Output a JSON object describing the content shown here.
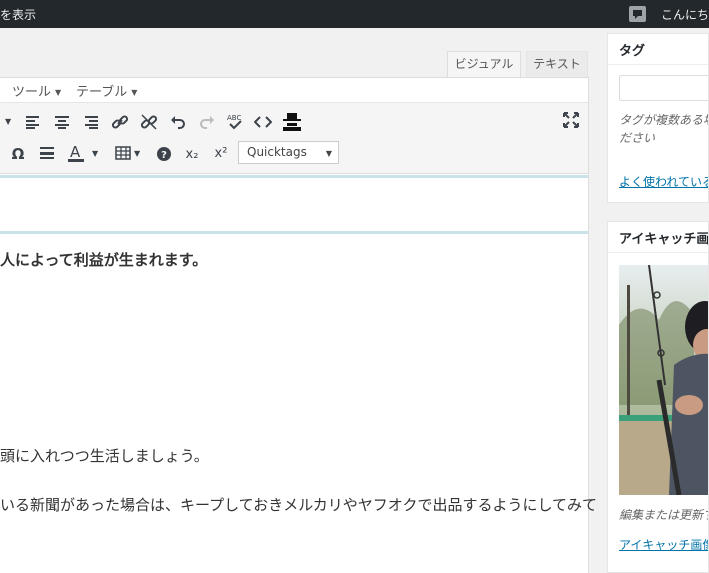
{
  "admin_bar": {
    "view_label": "を表示",
    "greeting": "こんにち"
  },
  "editor": {
    "tabs": {
      "visual": "ビジュアル",
      "text": "テキスト"
    },
    "menus": {
      "tools": "ツール",
      "table": "テーブル"
    },
    "toolbar": {
      "quicktags_select": "Quicktags",
      "text_color_glyph": "A",
      "special_char_glyph": "Ω",
      "help_glyph": "?",
      "subscript_glyph": "x₂",
      "superscript_glyph": "x²"
    },
    "content": {
      "line1": "人によって利益が生まれます。",
      "line2": "頭に入れつつ生活しましょう。",
      "line3": "いる新聞があった場合は、キープしておきメルカリやヤフオクで出品するようにしてみて"
    }
  },
  "sidebar": {
    "tags": {
      "title": "タグ",
      "hint_line1": "タグが複数ある場",
      "hint_line2": "ださい",
      "popular_link": "よく使われている"
    },
    "featured_image": {
      "title": "アイキャッチ画像",
      "hint": "編集または更新す",
      "link": "アイキャッチ画像"
    }
  },
  "colors": {
    "admin_bar_bg": "#23282d",
    "link": "#0073aa",
    "content_band": "#c9e3e8"
  },
  "icons": [
    "align-left-icon",
    "align-center-icon",
    "align-right-icon",
    "link-icon",
    "unlink-icon",
    "undo-icon",
    "redo-icon",
    "spellcheck-icon",
    "code-icon",
    "toolbar-toggle-icon",
    "fullscreen-icon",
    "omega-icon",
    "horizontal-rule-icon",
    "text-color-icon",
    "table-icon",
    "help-icon",
    "subscript-icon",
    "superscript-icon",
    "comment-bubble-icon"
  ]
}
